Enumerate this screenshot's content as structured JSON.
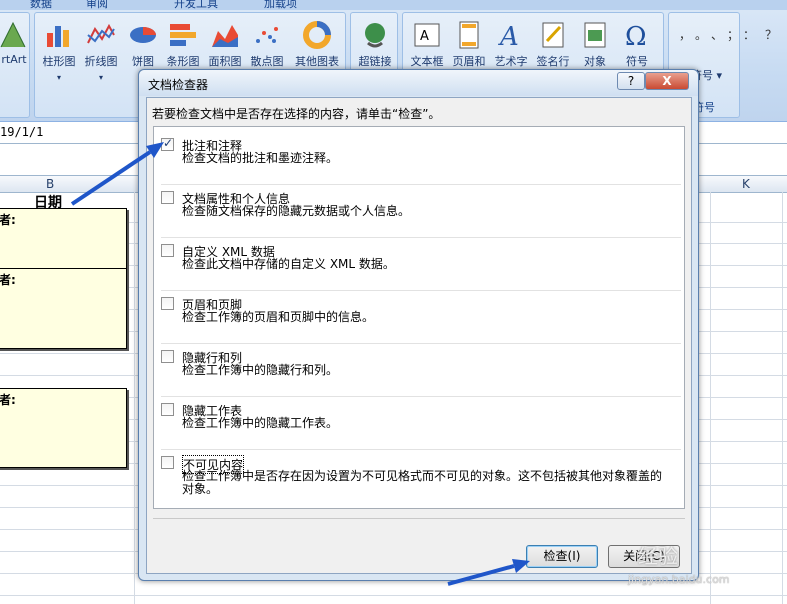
{
  "ribbon": {
    "tabs": [
      "数据",
      "审阅",
      "开发工具",
      "加载项"
    ],
    "buttons": [
      {
        "label": "rtArt",
        "icon": "wordart-icon"
      },
      {
        "label": "柱形图",
        "icon": "column-chart-icon"
      },
      {
        "label": "折线图",
        "icon": "line-chart-icon"
      },
      {
        "label": "饼图",
        "icon": "pie-chart-icon"
      },
      {
        "label": "条形图",
        "icon": "bar-chart-icon"
      },
      {
        "label": "面积图",
        "icon": "area-chart-icon"
      },
      {
        "label": "散点图",
        "icon": "scatter-chart-icon"
      },
      {
        "label": "其他图表",
        "icon": "other-chart-icon"
      },
      {
        "label": "超链接",
        "icon": "hyperlink-icon"
      },
      {
        "label": "文本框",
        "icon": "textbox-icon"
      },
      {
        "label": "页眉和",
        "icon": "header-footer-icon"
      },
      {
        "label": "艺术字",
        "icon": "wordart-a-icon"
      },
      {
        "label": "签名行",
        "icon": "signature-icon"
      },
      {
        "label": "对象",
        "icon": "object-icon"
      },
      {
        "label": "符号",
        "icon": "omega-icon"
      }
    ],
    "symbols_label": "符号",
    "symbols_group": "符号",
    "symbol_chars": "，。、；：？"
  },
  "formula_bar": {
    "value": "19/1/1"
  },
  "sheet": {
    "columns": [
      "B",
      "K"
    ],
    "header_cell": "日期",
    "note_label": "者:"
  },
  "dialog": {
    "title": "文档检查器",
    "help_label": "?",
    "close_label": "X",
    "prompt": "若要检查文档中是否存在选择的内容，请单击“检查”。",
    "items": [
      {
        "title": "批注和注释",
        "desc": "检查文档的批注和墨迹注释。",
        "checked": true
      },
      {
        "title": "文档属性和个人信息",
        "desc": "检查随文档保存的隐藏元数据或个人信息。",
        "checked": false
      },
      {
        "title": "自定义 XML 数据",
        "desc": "检查此文档中存储的自定义 XML 数据。",
        "checked": false
      },
      {
        "title": "页眉和页脚",
        "desc": "检查工作簿的页眉和页脚中的信息。",
        "checked": false
      },
      {
        "title": "隐藏行和列",
        "desc": "检查工作簿中的隐藏行和列。",
        "checked": false
      },
      {
        "title": "隐藏工作表",
        "desc": "检查工作簿中的隐藏工作表。",
        "checked": false
      },
      {
        "title": "不可见内容",
        "desc": "检查工作簿中是否存在因为设置为不可见格式而不可见的对象。这不包括被其他对象覆盖的对象。",
        "checked": false
      }
    ],
    "inspect_label": "检查(I)",
    "close_button_label": "关闭(C)"
  },
  "watermark": {
    "line1": "经验",
    "line2": "jingyan.baidu.com"
  },
  "colors": {
    "arrow": "#1f56c9",
    "note_bg": "#ffffe1",
    "dialog_bg": "#d9e6f3"
  }
}
